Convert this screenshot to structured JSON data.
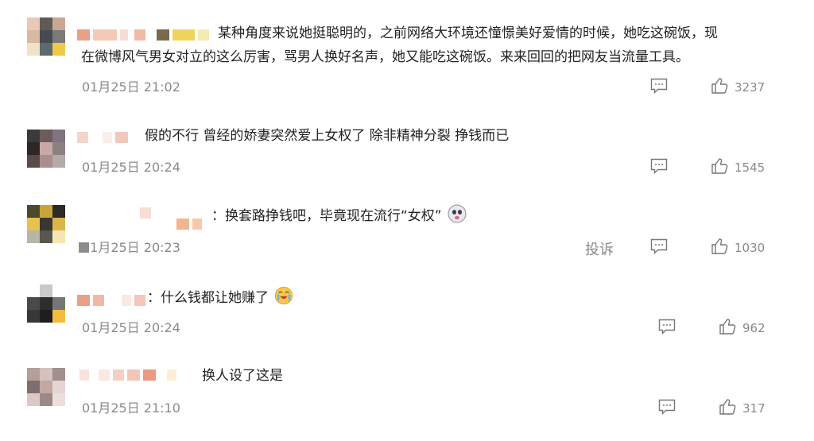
{
  "comments": [
    {
      "text_lines": [
        "某种角度来说她挺聪明的，之前网络大环境还憧憬美好爱情的时候，她吃这碗饭，现",
        "在微博风气男女对立的这么厉害，骂男人换好名声，她又能吃这碗饭。来来回回的把网友当流量工具。"
      ],
      "time": "01月25日 21:02",
      "likes": "3237"
    },
    {
      "text_lines": [
        "假的不行 曾经的娇妻突然爱上女权了 除非精神分裂 挣钱而已"
      ],
      "time": "01月25日 20:24",
      "likes": "1545"
    },
    {
      "text_lines": [
        "：换套路挣钱吧，毕竟现在流行“女权”"
      ],
      "time": "01月25日 20:23",
      "likes": "1030",
      "report": "投诉"
    },
    {
      "text_lines": [
        "：什么钱都让她赚了"
      ],
      "time": "01月25日 20:24",
      "likes": "962"
    },
    {
      "text_lines": [
        "换人设了这是"
      ],
      "time": "01月25日 21:10",
      "likes": "317"
    }
  ]
}
